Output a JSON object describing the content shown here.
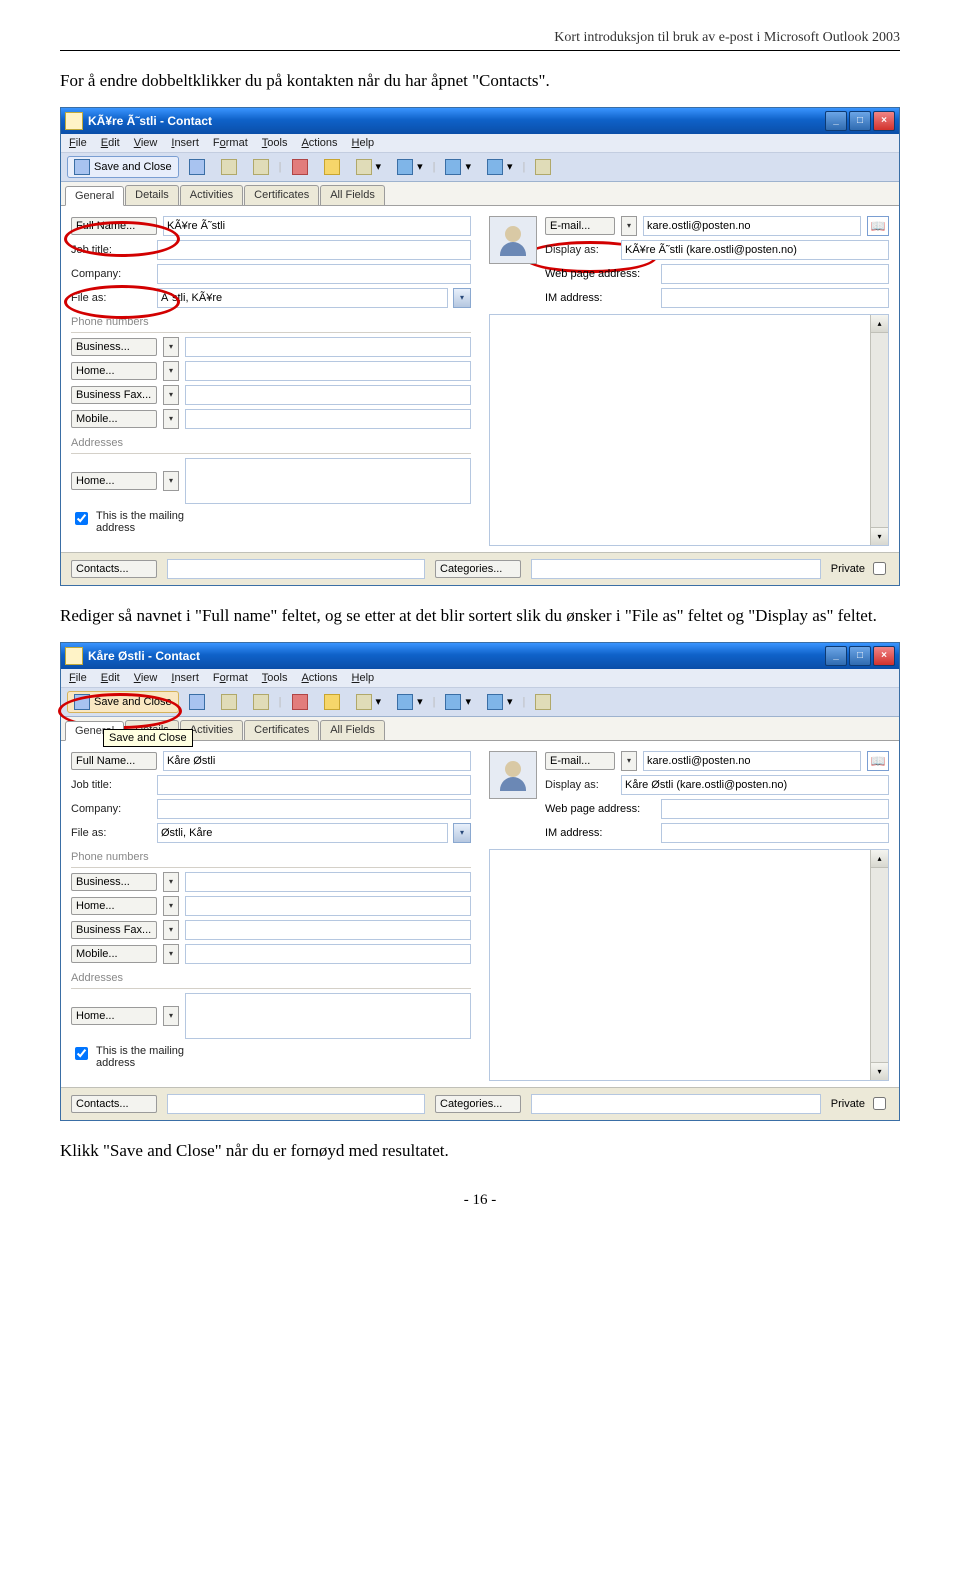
{
  "doc": {
    "header": "Kort introduksjon til bruk av e-post i Microsoft Outlook 2003",
    "para1": "For å endre dobbeltklikker du på kontakten når du har åpnet \"Contacts\".",
    "para2": "Rediger så navnet i \"Full name\" feltet, og se etter at det blir sortert slik du ønsker i \"File as\" feltet og \"Display as\" feltet.",
    "para3": "Klikk \"Save and Close\" når du er fornøyd med resultatet.",
    "page_number": "- 16 -"
  },
  "shot1": {
    "title": "KÃ¥re Ã˜stli - Contact",
    "menus": [
      "File",
      "Edit",
      "View",
      "Insert",
      "Format",
      "Tools",
      "Actions",
      "Help"
    ],
    "save_close": "Save and Close",
    "tabs": [
      "General",
      "Details",
      "Activities",
      "Certificates",
      "All Fields"
    ],
    "fullname_btn": "Full Name...",
    "fullname_val": "KÃ¥re Ã˜stli",
    "jobtitle_lbl": "Job title:",
    "company_lbl": "Company:",
    "fileas_lbl": "File as:",
    "fileas_val": "Ã˜stli, KÃ¥re",
    "phone_section": "Phone numbers",
    "phones": [
      "Business...",
      "Home...",
      "Business Fax...",
      "Mobile..."
    ],
    "addr_section": "Addresses",
    "addr_home": "Home...",
    "mailing_chk": "This is the mailing address",
    "email_btn": "E-mail...",
    "email_val": "kare.ostli@posten.no",
    "display_lbl": "Display as:",
    "display_val": "KÃ¥re Ã˜stli (kare.ostli@posten.no)",
    "web_lbl": "Web page address:",
    "im_lbl": "IM address:",
    "contacts_btn": "Contacts...",
    "categories_btn": "Categories...",
    "private_lbl": "Private"
  },
  "shot2": {
    "title": "Kåre Østli - Contact",
    "menus": [
      "File",
      "Edit",
      "View",
      "Insert",
      "Format",
      "Tools",
      "Actions",
      "Help"
    ],
    "save_close": "Save and Close",
    "tooltip": "Save and Close",
    "tabs": [
      "General",
      "Details",
      "Activities",
      "Certificates",
      "All Fields"
    ],
    "fullname_btn": "Full Name...",
    "fullname_val": "Kåre Østli",
    "jobtitle_lbl": "Job title:",
    "company_lbl": "Company:",
    "fileas_lbl": "File as:",
    "fileas_val": "Østli, Kåre",
    "phone_section": "Phone numbers",
    "phones": [
      "Business...",
      "Home...",
      "Business Fax...",
      "Mobile..."
    ],
    "addr_section": "Addresses",
    "addr_home": "Home...",
    "mailing_chk": "This is the mailing address",
    "email_btn": "E-mail...",
    "email_val": "kare.ostli@posten.no",
    "display_lbl": "Display as:",
    "display_val": "Kåre Østli (kare.ostli@posten.no)",
    "web_lbl": "Web page address:",
    "im_lbl": "IM address:",
    "contacts_btn": "Contacts...",
    "categories_btn": "Categories...",
    "private_lbl": "Private"
  }
}
